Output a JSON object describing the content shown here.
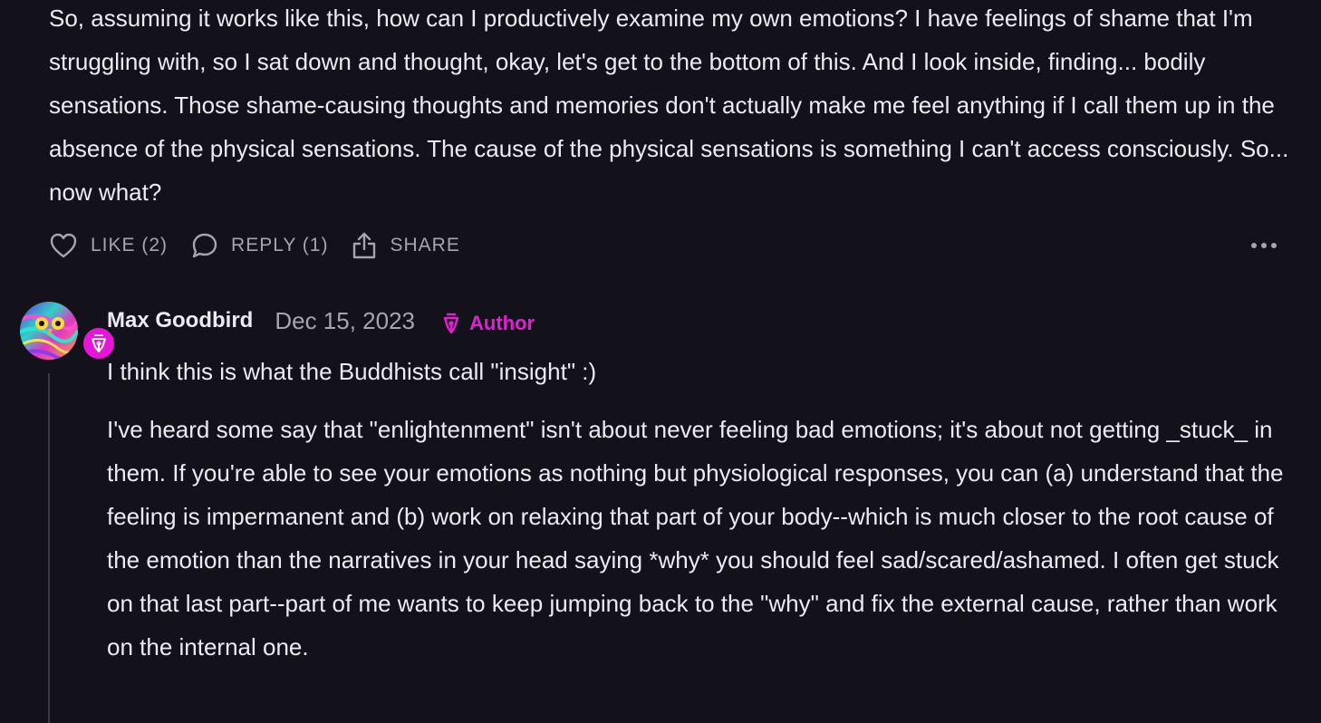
{
  "top_comment": {
    "text": "So, assuming it works like this, how can I productively examine my own emotions? I have feelings of shame that I'm struggling with, so I sat down and thought, okay, let's get to the bottom of this. And I look inside, finding... bodily sensations. Those shame-causing thoughts and memories don't actually make me feel anything if I call them up in the absence of the physical sensations. The cause of the physical sensations is something I can't access consciously. So... now what?",
    "actions": {
      "like_label": "LIKE (2)",
      "reply_label": "REPLY (1)",
      "share_label": "SHARE",
      "like_icon": "heart-icon",
      "reply_icon": "speech-bubble-icon",
      "share_icon": "share-icon",
      "more_icon": "more-horizontal-icon"
    }
  },
  "reply": {
    "author": "Max Goodbird",
    "date": "Dec 15, 2023",
    "author_tag": "Author",
    "author_tag_icon": "pen-nib-icon",
    "paragraphs": [
      "I think this is what the Buddhists call \"insight\" :)",
      "I've heard some say that \"enlightenment\" isn't about never feeling bad emotions; it's about not getting _stuck_ in them. If you're able to see your emotions as nothing but physiological responses, you can (a) understand that the feeling is impermanent and (b) work on relaxing that part of your body--which is much closer to the root cause of the emotion than the narratives in your head saying *why* you should feel sad/scared/ashamed. I often get stuck on that last part--part of me wants to keep jumping back to the \"why\" and fix the external cause, rather than work on the internal one."
    ]
  },
  "colors": {
    "background": "#13111a",
    "text": "#ecebef",
    "muted": "#a7a4b0",
    "author_accent": "#e21fd4"
  }
}
